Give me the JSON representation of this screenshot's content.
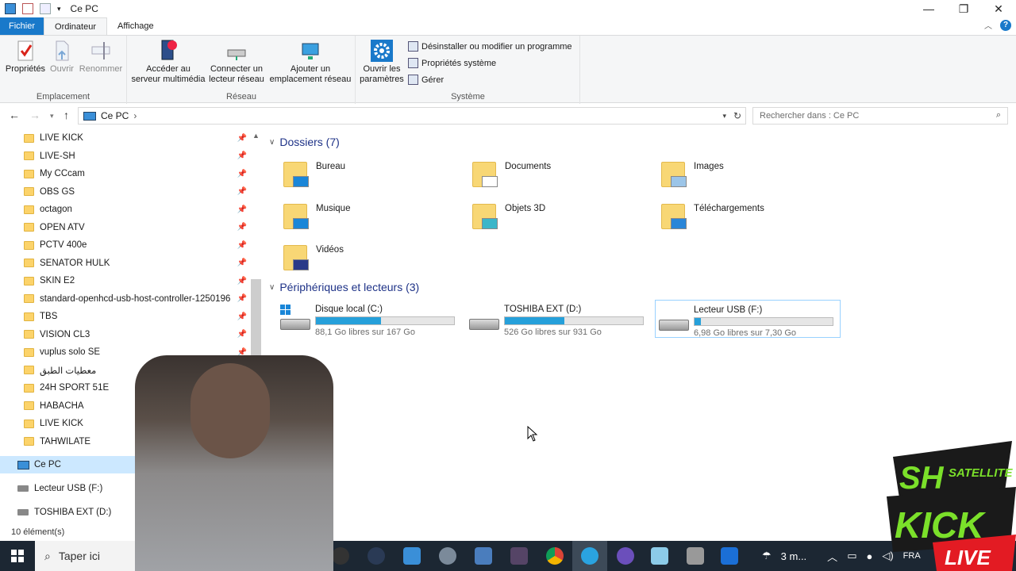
{
  "window": {
    "title": "Ce PC"
  },
  "ribbon_tabs": [
    "Fichier",
    "Ordinateur",
    "Affichage"
  ],
  "ribbon": {
    "emplacement": {
      "label": "Emplacement",
      "buttons": [
        "Propriétés",
        "Ouvrir",
        "Renommer"
      ]
    },
    "reseau": {
      "label": "Réseau",
      "buttons": [
        "Accéder au serveur multimédia",
        "Connecter un lecteur réseau",
        "Ajouter un emplacement réseau"
      ]
    },
    "systeme": {
      "label": "Système",
      "big_button": "Ouvrir les paramètres",
      "small_buttons": [
        "Désinstaller ou modifier un programme",
        "Propriétés système",
        "Gérer"
      ]
    }
  },
  "address": {
    "path": "Ce PC",
    "search_placeholder": "Rechercher dans : Ce PC"
  },
  "nav_pane": {
    "quick_access": [
      "LIVE KICK",
      "LIVE-SH",
      "My CCcam",
      "OBS GS",
      "octagon",
      "OPEN ATV",
      "PCTV 400e",
      "SENATOR HULK",
      "SKIN E2",
      "standard-openhcd-usb-host-controller-1250196",
      "TBS",
      "VISION CL3",
      "vuplus solo SE",
      "معطيات الطبق",
      "24H SPORT 51E",
      "HABACHA",
      "LIVE KICK",
      "TAHWILATE"
    ],
    "this_pc": "Ce PC",
    "drives": [
      "Lecteur USB (F:)",
      "TOSHIBA EXT (D:)"
    ]
  },
  "folders_section": {
    "title": "Dossiers (7)",
    "items": [
      "Bureau",
      "Documents",
      "Images",
      "Musique",
      "Objets 3D",
      "Téléchargements",
      "Vidéos"
    ]
  },
  "devices_section": {
    "title": "Périphériques et lecteurs (3)",
    "items": [
      {
        "name": "Disque local (C:)",
        "free": "88,1 Go libres sur 167 Go",
        "used_fraction": 0.47
      },
      {
        "name": "TOSHIBA EXT (D:)",
        "free": "526 Go libres sur 931 Go",
        "used_fraction": 0.43
      },
      {
        "name": "Lecteur USB (F:)",
        "free": "6,98 Go libres sur 7,30 Go",
        "used_fraction": 0.044
      }
    ]
  },
  "status": {
    "count": "10 élément(s)"
  },
  "taskbar": {
    "search_placeholder": "Taper ici",
    "weather": "3 m...",
    "lang": "FRA"
  },
  "overlay": {
    "logo_lines": [
      "SH",
      "SATELLITE",
      "KICK",
      "LIVE"
    ]
  },
  "colors": {
    "accent": "#1979ca",
    "drive_bar": "#26a0da",
    "selection": "#cce8ff"
  }
}
